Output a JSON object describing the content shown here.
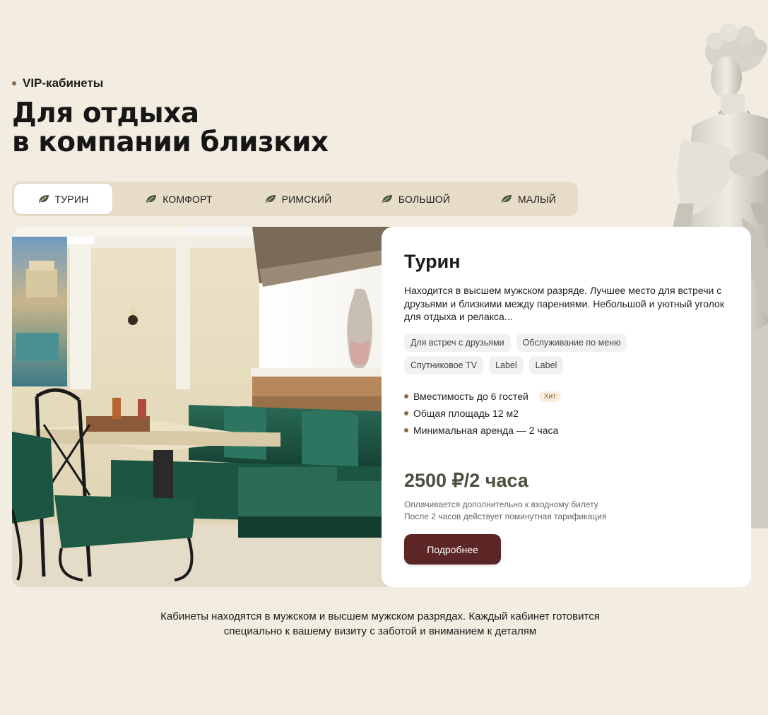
{
  "section": {
    "eyebrow": "VIP-кабинеты",
    "title_line1": "Для отдыха",
    "title_line2": "в компании близких"
  },
  "tabs": [
    {
      "label": "ТУРИН",
      "active": true
    },
    {
      "label": "КОМФОРТ",
      "active": false
    },
    {
      "label": "РИМСКИЙ",
      "active": false
    },
    {
      "label": "БОЛЬШОЙ",
      "active": false
    },
    {
      "label": "МАЛЫЙ",
      "active": false
    }
  ],
  "card": {
    "title": "Турин",
    "description": "Находится в высшем мужском разряде. Лучшее место для встречи с друзьями и близкими между парениями. Небольшой и уютный уголок для отдыха и релакса...",
    "tags": [
      "Для встреч с друзьями",
      "Обслуживание по меню",
      "Спутниковое TV",
      "Label",
      "Label"
    ],
    "features": [
      {
        "text": "Вместимость до 6 гостей",
        "badge": "Хит"
      },
      {
        "text": "Общая площадь 12 м2"
      },
      {
        "text": "Минимальная аренда — 2 часа"
      }
    ],
    "price": "2500 ₽/2 часа",
    "price_note_1": "Оплачивается дополнительно к входному билету",
    "price_note_2": "После 2 часов действует поминутная тарификация",
    "button_label": "Подробнее"
  },
  "footer": {
    "line1": "Кабинеты находятся в мужском и высшем мужском разрядах. Каждый кабинет готовится",
    "line2": "специально к вашему визиту с заботой и вниманием к деталям"
  },
  "colors": {
    "background": "#f2ede0",
    "tabs_bg": "#e6dcc8",
    "accent_bullet": "#8a6a4a",
    "price": "#4b4f3e",
    "button": "#5c2626",
    "leaf_icon": "#4b5a3e"
  },
  "icons": {
    "tab_icon": "leaf-icon"
  }
}
